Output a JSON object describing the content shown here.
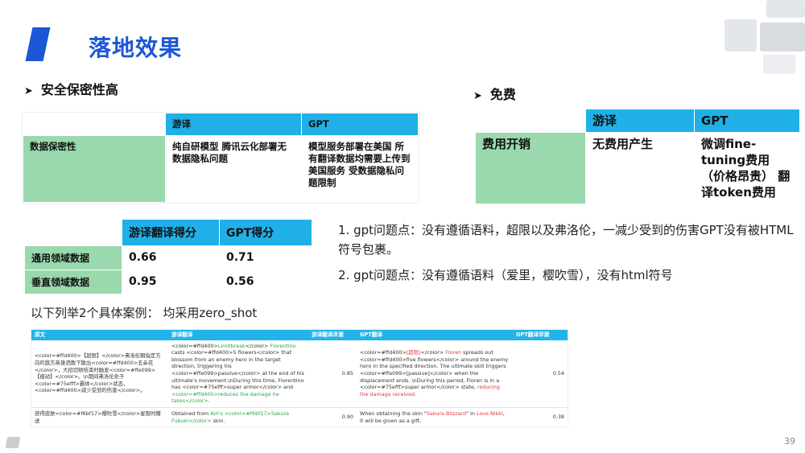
{
  "title": "落地效果",
  "security": {
    "heading": "安全保密性高",
    "table": {
      "col_youyi": "游译",
      "col_gpt": "GPT",
      "row_label": "数据保密性",
      "youyi_text": "纯自研模型 腾讯云化部署无数据隐私问题",
      "gpt_text": "模型服务部署在美国 所有翻译数据均需要上传到美国服务 受数据隐私问题限制"
    }
  },
  "cost": {
    "heading": "免费",
    "table": {
      "col_youyi": "游译",
      "col_gpt": "GPT",
      "row_label": "费用开销",
      "youyi_text": "无费用产生",
      "gpt_text": "微调fine-tuning费用（价格昂贵） 翻译token费用"
    }
  },
  "scores": {
    "col_youyi": "游译翻译得分",
    "col_gpt": "GPT得分",
    "rows": [
      {
        "label": "通用领域数据",
        "youyi": "0.66",
        "gpt": "0.71"
      },
      {
        "label": "垂直领域数据",
        "youyi": "0.95",
        "gpt": "0.56"
      }
    ]
  },
  "points": [
    "1.    gpt问题点：没有遵循语料，超限以及弗洛伦，一减少受到的伤害GPT没有被HTML符号包裹。",
    "2.    gpt问题点：没有遵循语料（爱里，樱吹雪），没有html符号"
  ],
  "caption": "以下列举2个具体案例：  均采用zero_shot",
  "cases": {
    "headers": [
      "原文",
      "游译翻译",
      "游译翻译评测",
      "GPT翻译",
      "GPT翻译评测"
    ],
    "rows": [
      {
        "source": "<color=#ffd400>【超限】</color>弗洛伦朝指定方向的敌方英雄洒散下散出<color=#ffd400>五朵花</color>，大招切顿结束时触发<color=#ffe099>【被动】</color>。\\n期间弗洛伦处于<color=#75efff>霸体</color>状态，<color=#ffd400>减少受到的伤害</color>。",
        "youyi_a": "<color=#ffd400>",
        "youyi_b": "Limitbreak",
        "youyi_c": "</color> ",
        "youyi_d": "Florentino",
        "youyi_e": " casts <color=#ffd400>5 flowers</color> that blossom from an enemy hero in the target direction, triggering his <color=#ffe099>passive</color> at the end of his ultimate's movement.\\nDuring this time, Florentino has <color=#75efff>super armor</color> and ",
        "youyi_f": "<color=#ffd400>reduces the damage he takes</color>",
        "youyi_g": ".",
        "youyi_score": "0.85",
        "gpt_a": "<color=#ffd400>",
        "gpt_b": "[超限]",
        "gpt_c": "</color> ",
        "gpt_d": "Floren",
        "gpt_e": " spreads out <color=#ffd400>five flowers</color> around the enemy hero in the specified direction. The ultimate skill triggers <color=#ffe099>[passive]</color> when the displacement ends. \\nDuring this period, Floren is in a <color=#75efff>super armor</color> state, ",
        "gpt_f": "reducing the damage received",
        "gpt_g": ".",
        "gpt_score": "0.54"
      },
      {
        "source": "获得皮肤<color=#f6bf17>樱吹雪</color>星限时赠送",
        "youyi_a": "Obtained from ",
        "youyi_b": "Airi's",
        "youyi_c": " ",
        "youyi_d": "<color=#f6bf17>Sakura Fubuki</color>",
        "youyi_e": " skin.",
        "youyi_score": "0.90",
        "gpt_a": "When obtaining the skin \"",
        "gpt_b": "Sakura Blizzard",
        "gpt_c": "\" in ",
        "gpt_d": "Love Nikki",
        "gpt_e": ", it will be given as a gift.",
        "gpt_score": "0.38"
      }
    ]
  },
  "page_number": "39",
  "colors": {
    "accent": "#1a56d6",
    "header": "#20b0e8",
    "label": "#99d9ad",
    "green_text": "#2aa84a",
    "red_text": "#e03a3a"
  }
}
